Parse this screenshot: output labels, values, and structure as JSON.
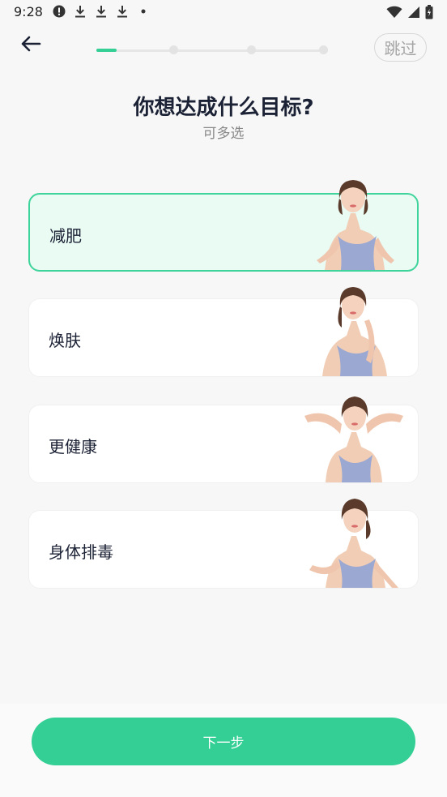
{
  "status_bar": {
    "time": "9:28",
    "left_icons": [
      "alert-icon",
      "download-icon",
      "download-icon",
      "download-icon",
      "dot-icon"
    ],
    "right_icons": [
      "wifi-icon",
      "signal-icon",
      "battery-icon"
    ]
  },
  "header": {
    "skip_label": "跳过",
    "progress": {
      "current_step": 1,
      "total_steps": 4
    }
  },
  "title": "你想达成什么目标?",
  "subtitle": "可多选",
  "options": [
    {
      "label": "减肥",
      "selected": true,
      "illustration": "woman-hands-on-hips"
    },
    {
      "label": "焕肤",
      "selected": false,
      "illustration": "woman-touching-face"
    },
    {
      "label": "更健康",
      "selected": false,
      "illustration": "woman-arms-behind-head"
    },
    {
      "label": "身体排毒",
      "selected": false,
      "illustration": "woman-running"
    }
  ],
  "next_button": "下一步",
  "colors": {
    "accent": "#34cf95",
    "selected_bg": "#e9fbf3",
    "selected_border": "#3ed49b",
    "title_text": "#1c2235",
    "page_bg": "#f7f7f7"
  }
}
